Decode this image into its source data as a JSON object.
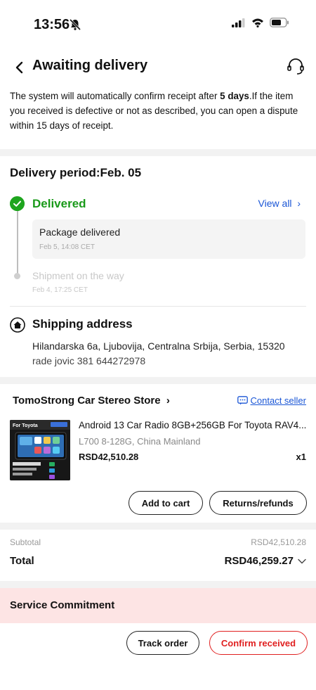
{
  "status": {
    "time": "13:56"
  },
  "header": {
    "title": "Awaiting delivery"
  },
  "notice": {
    "before": "The system will automatically confirm receipt after ",
    "bold": "5 days",
    "after": ".If the item you received is defective or not as described, you can open a dispute within 15 days of receipt."
  },
  "delivery": {
    "title": "Delivery period:Feb. 05",
    "status": "Delivered",
    "view_all": "View all",
    "events": [
      {
        "title": "Package delivered",
        "time": "Feb 5, 14:08 CET"
      },
      {
        "title": "Shipment on the way",
        "time": "Feb 4, 17:25 CET"
      }
    ]
  },
  "address": {
    "title": "Shipping address",
    "line": "Hilandarska 6a, Ljubovija, Centralna Srbija, Serbia, 15320",
    "contact": "rade jovic 381 644272978"
  },
  "store": {
    "name": "TomoStrong Car Stereo Store",
    "contact": "Contact seller"
  },
  "product": {
    "name": "Android 13 Car Radio 8GB+256GB For Toyota RAV4...",
    "variant": "L700 8-128G, China Mainland",
    "price": "RSD42,510.28",
    "qty": "x1",
    "image_text": "For Toyota"
  },
  "actions": {
    "add_to_cart": "Add to cart",
    "returns": "Returns/refunds",
    "track": "Track order",
    "confirm": "Confirm received"
  },
  "summary": {
    "subtotal_label": "Subtotal",
    "subtotal": "RSD42,510.28",
    "total_label": "Total",
    "total": "RSD46,259.27"
  },
  "commitment": {
    "title": "Service Commitment"
  },
  "colors": {
    "green": "#1ea51e",
    "link": "#1a56d6",
    "red": "#e02020",
    "band": "#fde4e4"
  }
}
